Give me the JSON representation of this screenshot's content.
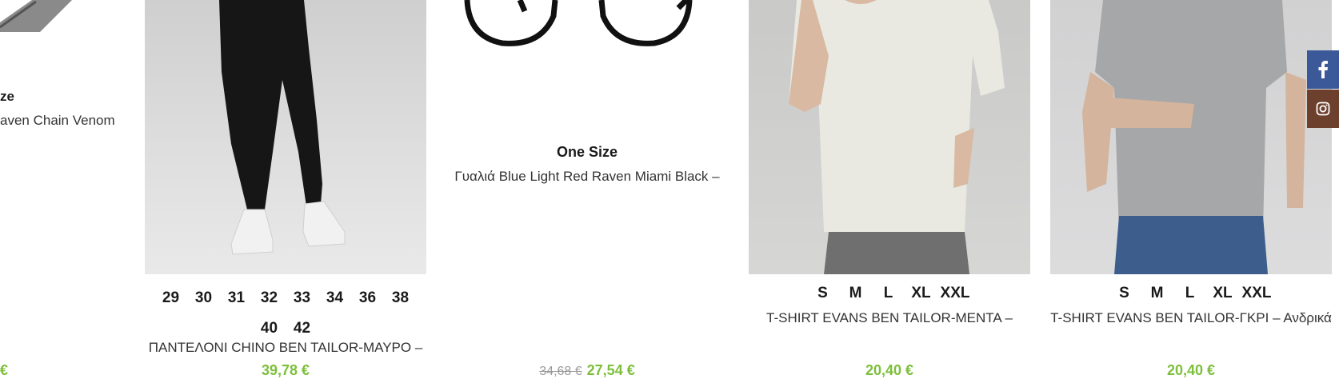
{
  "products": [
    {
      "id": "partial",
      "size_label": "ze",
      "title": "aven Chain Venom",
      "price": "€"
    },
    {
      "id": "chino",
      "sizes": [
        "29",
        "30",
        "31",
        "32",
        "33",
        "34",
        "36",
        "38",
        "40",
        "42"
      ],
      "title": "ΠΑΝΤΕΛΟΝΙ CHINO BEN TAILOR-ΜΑΥΡΟ –",
      "price": "39,78 €"
    },
    {
      "id": "glasses",
      "size_label": "One Size",
      "title": "Γυαλιά Blue Light Red Raven Miami Black –",
      "old_price": "34,68 €",
      "price": "27,54 €"
    },
    {
      "id": "tshirt-menta",
      "sizes": [
        "S",
        "M",
        "L",
        "XL",
        "XXL"
      ],
      "title": "T-SHIRT EVANS BEN TAILOR-ΜΕΝΤΑ –",
      "price": "20,40 €"
    },
    {
      "id": "tshirt-gkri",
      "sizes": [
        "S",
        "M",
        "L",
        "XL",
        "XXL"
      ],
      "title": "T-SHIRT EVANS BEN TAILOR-ΓΚΡΙ – Ανδρικά",
      "price": "20,40 €"
    }
  ],
  "social": {
    "facebook_icon": "facebook-icon",
    "instagram_icon": "instagram-icon"
  },
  "colors": {
    "price": "#7cbf3a",
    "facebook": "#3b5998",
    "instagram": "#6d3f2d"
  }
}
